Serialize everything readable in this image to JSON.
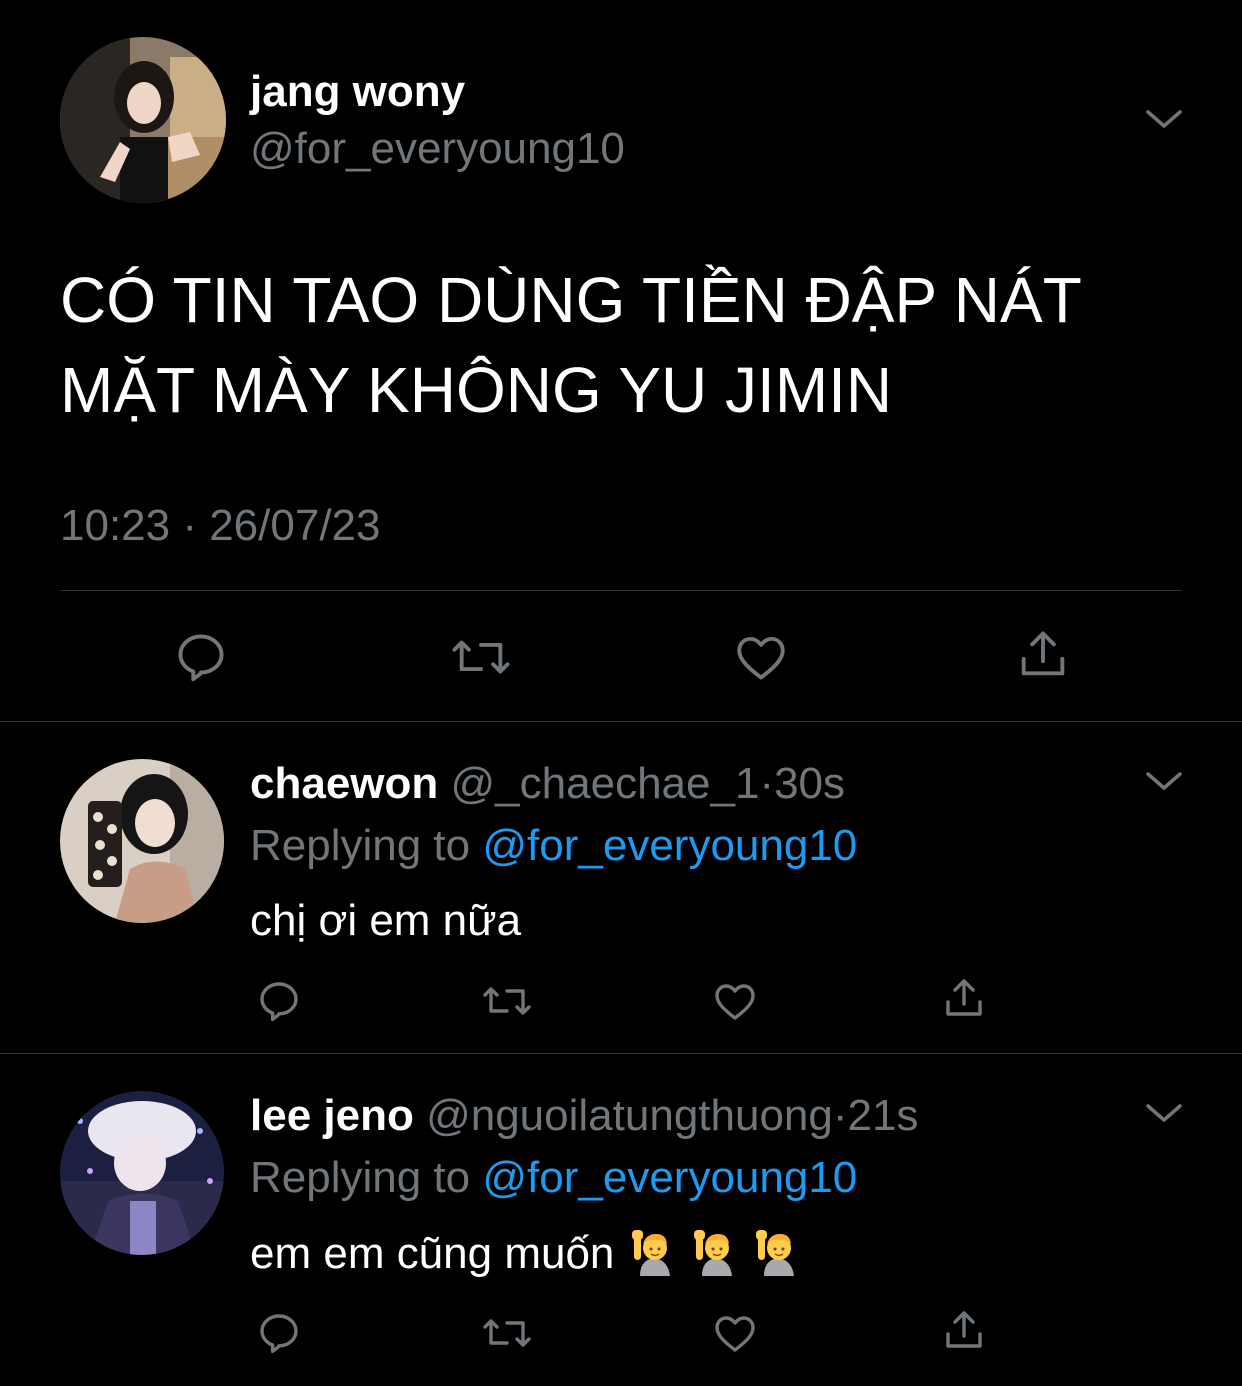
{
  "main_tweet": {
    "display_name": "jang wony",
    "handle": "@for_everyoung10",
    "text_line1": "CÓ TIN TAO DÙNG TIỀN ĐẬP NÁT",
    "text_line2": "MẶT MÀY KHÔNG YU JIMIN",
    "timestamp": "10:23 · 26/07/23",
    "avatar_icon": "profile-photo-woman-in-car",
    "more_icon": "chevron-down-icon"
  },
  "replies": [
    {
      "display_name": "chaewon",
      "handle": "@_chaechae_1",
      "separator": "·",
      "time": "30s",
      "replying_prefix": "Replying to",
      "replying_handle": "@for_everyoung10",
      "text": "chị ơi em nữa",
      "emoji_count": 0
    },
    {
      "display_name": "lee jeno",
      "handle": "@nguoilatungthuong",
      "separator": "·",
      "time": "21s",
      "replying_prefix": "Replying to",
      "replying_handle": "@for_everyoung10",
      "text": "em em cũng muốn",
      "emoji_count": 3,
      "emoji_name": "person-raising-hand"
    }
  ],
  "actions": [
    "reply-icon",
    "retweet-icon",
    "like-icon",
    "share-icon"
  ],
  "colors": {
    "background": "#000000",
    "text": "#ffffff",
    "secondary": "#71767b",
    "link": "#1d9bf0",
    "divider": "#2f3336"
  }
}
